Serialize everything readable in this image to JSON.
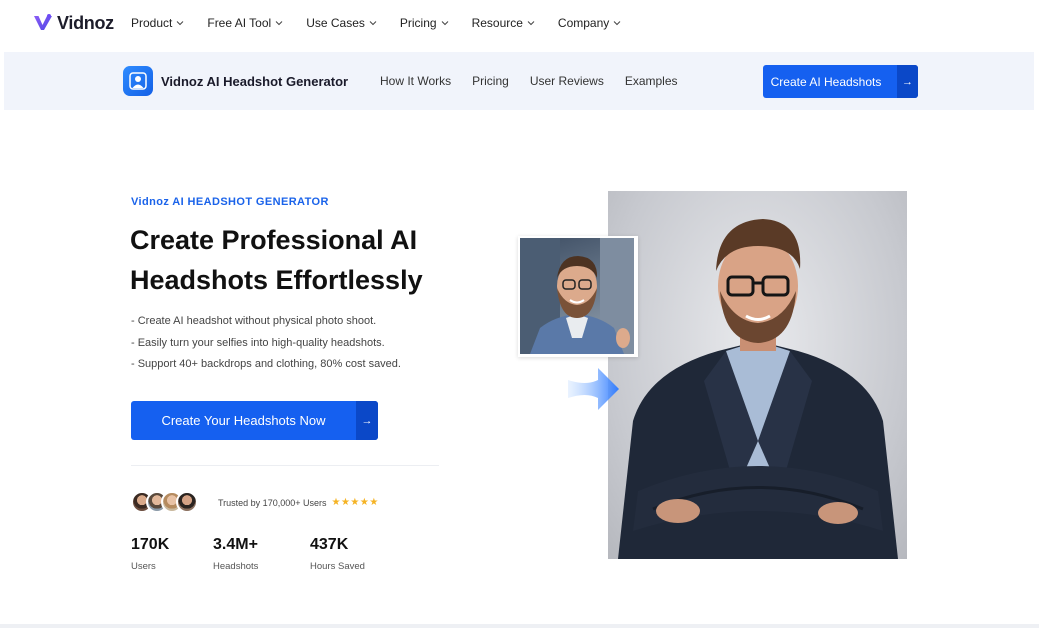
{
  "brand": {
    "name": "Vidnoz"
  },
  "topnav": {
    "items": [
      {
        "label": "Product"
      },
      {
        "label": "Free AI Tool"
      },
      {
        "label": "Use Cases"
      },
      {
        "label": "Pricing"
      },
      {
        "label": "Resource"
      },
      {
        "label": "Company"
      }
    ]
  },
  "subnav": {
    "product_name": "Vidnoz AI Headshot Generator",
    "links": [
      {
        "label": "How It Works"
      },
      {
        "label": "Pricing"
      },
      {
        "label": "User Reviews"
      },
      {
        "label": "Examples"
      }
    ],
    "cta_label": "Create AI Headshots",
    "cta_arrow": "→"
  },
  "hero": {
    "eyebrow": "Vidnoz AI HEADSHOT GENERATOR",
    "title_line1": "Create Professional AI",
    "title_line2": "Headshots Effortlessly",
    "bullets": [
      "-  Create AI headshot without physical photo shoot.",
      "-  Easily turn your selfies into high-quality headshots.",
      "-  Support 40+ backdrops and clothing, 80% cost saved."
    ],
    "cta_label": "Create Your Headshots Now",
    "cta_arrow": "→",
    "trusted_text": "Trusted by 170,000+ Users",
    "stars": "★★★★★",
    "rating": 5,
    "stats": [
      {
        "value": "170K",
        "label": "Users"
      },
      {
        "value": "3.4M+",
        "label": "Headshots"
      },
      {
        "value": "437K",
        "label": "Hours Saved"
      }
    ]
  },
  "colors": {
    "accent": "#1560f0",
    "accent_dark": "#0b48c8",
    "eyebrow": "#1a63ea",
    "star": "#f5b324",
    "subnav_bg": "#f1f4fb"
  },
  "icons": {
    "logo": "vidnoz-logo-icon",
    "product": "headshot-generator-icon",
    "chevron": "chevron-down-icon",
    "arrow": "arrow-right-icon"
  }
}
